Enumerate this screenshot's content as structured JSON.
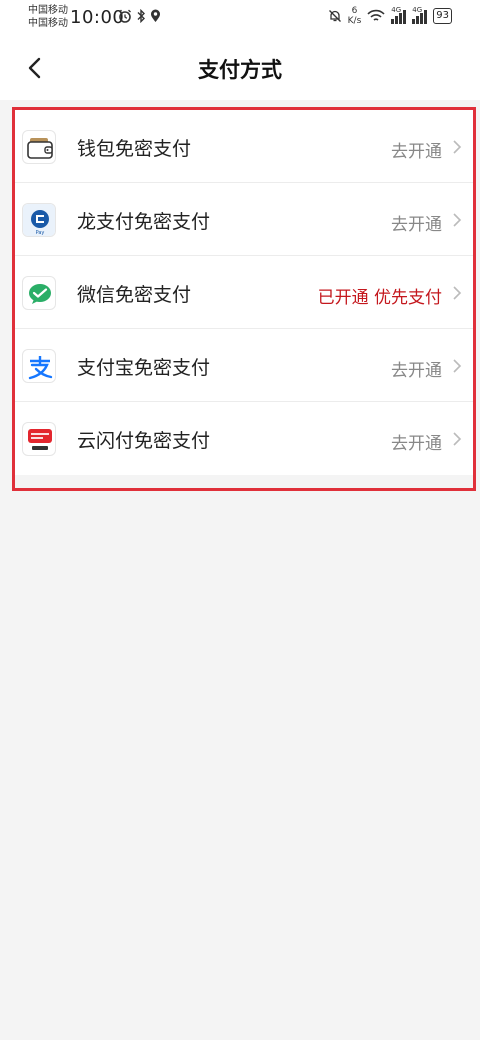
{
  "status_bar": {
    "carrier1": "中国移动",
    "carrier2": "中国移动",
    "time": "10:00",
    "net_speed_value": "6",
    "net_speed_unit": "K/s",
    "sim1_tag": "4G",
    "sim2_tag": "4G",
    "battery": "93"
  },
  "header": {
    "title": "支付方式"
  },
  "payment_methods": [
    {
      "label": "钱包免密支付",
      "status": "去开通",
      "icon": "wallet-icon"
    },
    {
      "label": "龙支付免密支付",
      "status": "去开通",
      "icon": "ccb-long-pay-icon"
    },
    {
      "label": "微信免密支付",
      "status": "已开通 优先支付",
      "icon": "wechat-pay-icon",
      "status_color": "#c4171d"
    },
    {
      "label": "支付宝免密支付",
      "status": "去开通",
      "icon": "alipay-icon"
    },
    {
      "label": "云闪付免密支付",
      "status": "去开通",
      "icon": "unionpay-quickpass-icon"
    }
  ],
  "colors": {
    "accent_red": "#c4171d",
    "highlight_border": "#e0303a",
    "background": "#f4f4f4"
  }
}
